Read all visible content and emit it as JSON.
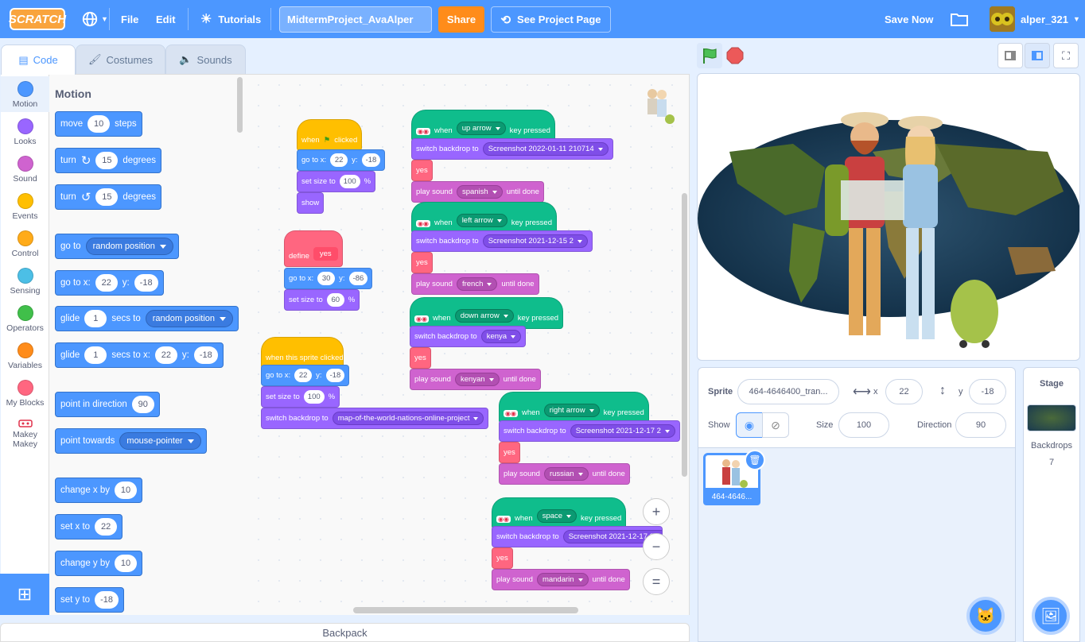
{
  "topbar": {
    "logo": "SCRATCH",
    "file": "File",
    "edit": "Edit",
    "tutorials": "Tutorials",
    "project_title": "MidtermProject_AvaAlper",
    "share": "Share",
    "see_project": "See Project Page",
    "save_now": "Save Now",
    "username": "alper_321"
  },
  "tabs": {
    "code": "Code",
    "costumes": "Costumes",
    "sounds": "Sounds"
  },
  "categories": [
    {
      "label": "Motion",
      "color": "#4c97ff"
    },
    {
      "label": "Looks",
      "color": "#9966ff"
    },
    {
      "label": "Sound",
      "color": "#cf63cf"
    },
    {
      "label": "Events",
      "color": "#ffbf00"
    },
    {
      "label": "Control",
      "color": "#ffab19"
    },
    {
      "label": "Sensing",
      "color": "#4cbfe6"
    },
    {
      "label": "Operators",
      "color": "#40bf4a"
    },
    {
      "label": "Variables",
      "color": "#ff8c1a"
    },
    {
      "label": "My Blocks",
      "color": "#ff6680"
    },
    {
      "label": "Makey Makey",
      "color": "#0fbd8c"
    }
  ],
  "palette": {
    "title": "Motion",
    "move": {
      "a": "move",
      "n": "10",
      "b": "steps"
    },
    "turn_cw": {
      "a": "turn",
      "n": "15",
      "b": "degrees"
    },
    "turn_ccw": {
      "a": "turn",
      "n": "15",
      "b": "degrees"
    },
    "goto": {
      "a": "go to",
      "d": "random position"
    },
    "gotoxy": {
      "a": "go to x:",
      "x": "22",
      "b": "y:",
      "y": "-18"
    },
    "glide": {
      "a": "glide",
      "n": "1",
      "b": "secs to",
      "d": "random position"
    },
    "glidexy": {
      "a": "glide",
      "n": "1",
      "b": "secs to x:",
      "x": "22",
      "c": "y:",
      "y": "-18"
    },
    "point": {
      "a": "point in direction",
      "n": "90"
    },
    "pointtowards": {
      "a": "point towards",
      "d": "mouse-pointer"
    },
    "changex": {
      "a": "change x by",
      "n": "10"
    },
    "setx": {
      "a": "set x to",
      "n": "22"
    },
    "changey": {
      "a": "change y by",
      "n": "10"
    },
    "sety": {
      "a": "set y to",
      "n": "-18"
    }
  },
  "scripts": {
    "flag": {
      "when": "when",
      "clicked": "clicked",
      "goto_a": "go to x:",
      "x": "22",
      "goto_b": "y:",
      "y": "-18",
      "size_a": "set size to",
      "size": "100",
      "size_b": "%",
      "show": "show"
    },
    "define": {
      "define": "define",
      "name": "yes",
      "goto_a": "go to x:",
      "x": "30",
      "goto_b": "y:",
      "y": "-86",
      "size_a": "set size to",
      "size": "60",
      "size_b": "%"
    },
    "sprite": {
      "hat": "when this sprite clicked",
      "goto_a": "go to x:",
      "x": "22",
      "goto_b": "y:",
      "y": "-18",
      "size_a": "set size to",
      "size": "100",
      "size_b": "%",
      "bd_a": "switch backdrop to",
      "bd": "map-of-the-world-nations-online-project"
    },
    "keys": [
      {
        "when": "when",
        "key": "up arrow",
        "pressed": "key pressed",
        "bd_a": "switch backdrop to",
        "bd": "Screenshot 2022-01-11 210714",
        "yes": "yes",
        "snd_a": "play sound",
        "snd": "spanish",
        "snd_b": "until done"
      },
      {
        "when": "when",
        "key": "left arrow",
        "pressed": "key pressed",
        "bd_a": "switch backdrop to",
        "bd": "Screenshot 2021-12-15 2",
        "yes": "yes",
        "snd_a": "play sound",
        "snd": "french",
        "snd_b": "until done"
      },
      {
        "when": "when",
        "key": "down arrow",
        "pressed": "key pressed",
        "bd_a": "switch backdrop to",
        "bd": "kenya",
        "yes": "yes",
        "snd_a": "play sound",
        "snd": "kenyan",
        "snd_b": "until done"
      },
      {
        "when": "when",
        "key": "right arrow",
        "pressed": "key pressed",
        "bd_a": "switch backdrop to",
        "bd": "Screenshot 2021-12-17 2",
        "yes": "yes",
        "snd_a": "play sound",
        "snd": "russian",
        "snd_b": "until done"
      },
      {
        "when": "when",
        "key": "space",
        "pressed": "key pressed",
        "bd_a": "switch backdrop to",
        "bd": "Screenshot 2021-12-17 3",
        "yes": "yes",
        "snd_a": "play sound",
        "snd": "mandarin",
        "snd_b": "until done"
      }
    ]
  },
  "zoom": {
    "in": "+",
    "out": "−",
    "reset": "="
  },
  "backpack": "Backpack",
  "sprite_info": {
    "sprite_label": "Sprite",
    "sprite_name": "464-4646400_tran...",
    "x_label": "x",
    "x": "22",
    "y_label": "y",
    "y": "-18",
    "show_label": "Show",
    "size_label": "Size",
    "size": "100",
    "direction_label": "Direction",
    "direction": "90"
  },
  "sprite_list": [
    {
      "name": "464-4646..."
    }
  ],
  "stage_panel": {
    "title": "Stage",
    "backdrops_label": "Backdrops",
    "backdrops_count": "7"
  },
  "colors": {
    "accent": "#4c97ff",
    "share": "#ff8c1a",
    "flag": "#4cbf56",
    "stop": "#ec5959"
  }
}
